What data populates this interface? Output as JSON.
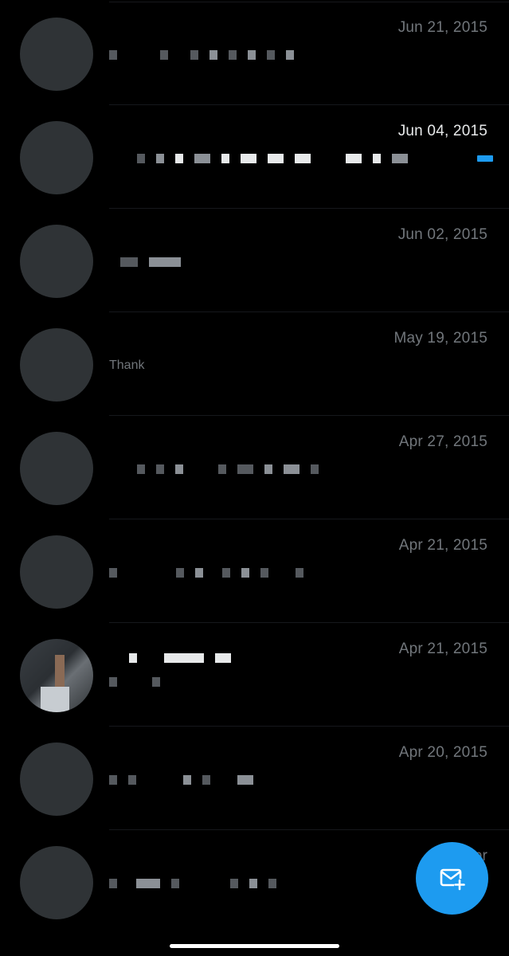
{
  "conversations": [
    {
      "date": "Jun 21, 2015",
      "unread": false,
      "preview": ""
    },
    {
      "date": "Jun 04, 2015",
      "unread": true,
      "preview": ""
    },
    {
      "date": "Jun 02, 2015",
      "unread": false,
      "preview": ""
    },
    {
      "date": "May 19, 2015",
      "unread": false,
      "preview": "Thank"
    },
    {
      "date": "Apr 27, 2015",
      "unread": false,
      "preview": ""
    },
    {
      "date": "Apr 21, 2015",
      "unread": false,
      "preview": ""
    },
    {
      "date": "Apr 21, 2015",
      "unread": false,
      "preview": ""
    },
    {
      "date": "Apr 20, 2015",
      "unread": false,
      "preview": ""
    },
    {
      "date": "Apr",
      "unread": false,
      "preview": ""
    }
  ],
  "fab": {
    "icon": "new-message-icon"
  },
  "colors": {
    "background": "#000000",
    "accent": "#1d9bf0",
    "date_read": "#71767b",
    "date_unread": "#e7e9ea",
    "avatar_placeholder": "#2f3336"
  }
}
